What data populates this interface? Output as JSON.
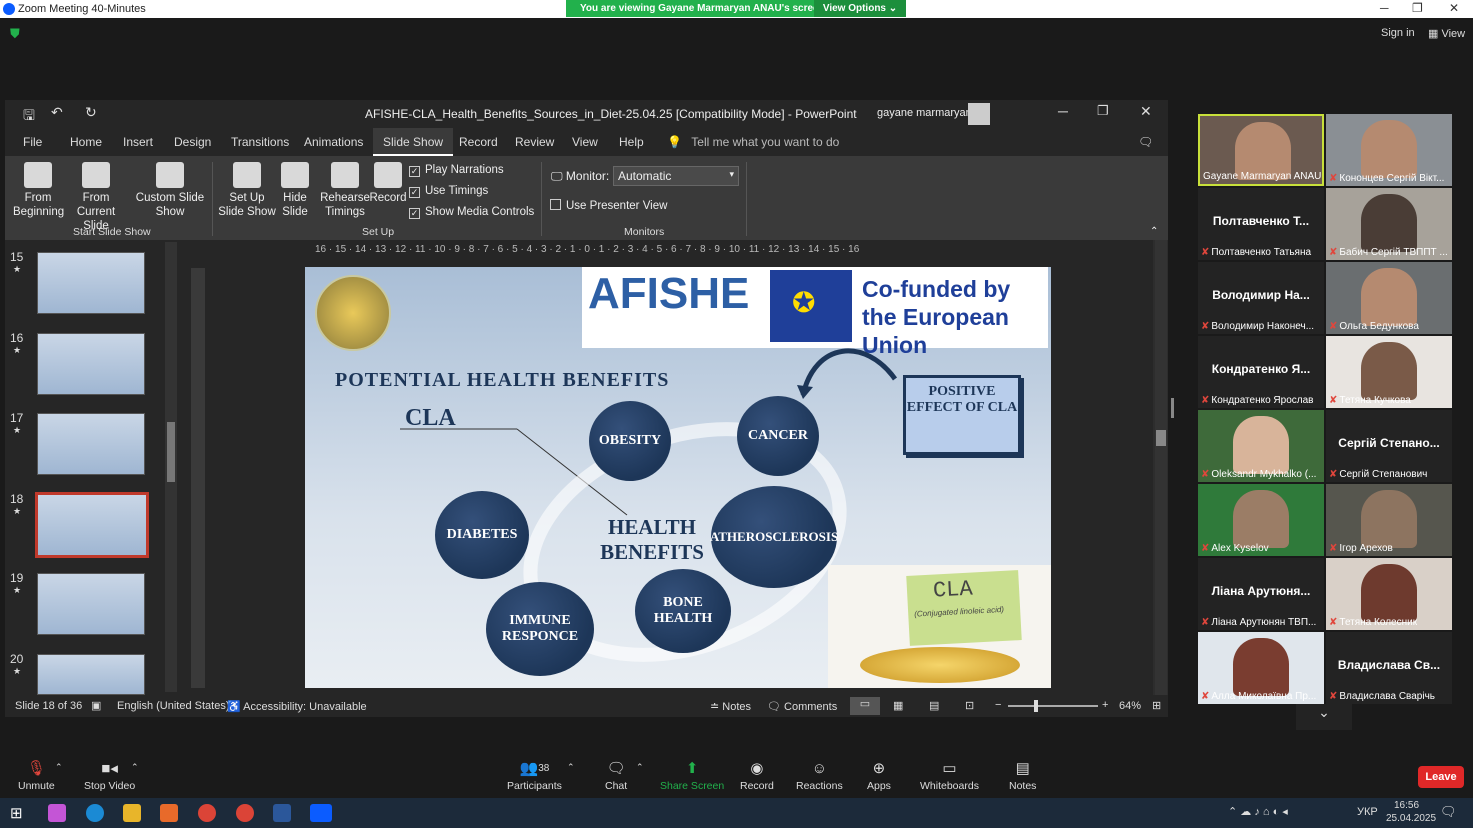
{
  "zoom": {
    "window_title": "Zoom Meeting 40-Minutes",
    "banner_text": "You are viewing Gayane Marmaryan ANAU's screen",
    "view_options": "View Options",
    "sign_in": "Sign in",
    "view": "View"
  },
  "ppt": {
    "title": "AFISHE-CLA_Health_Benefits_Sources_in_Diet-25.04.25 [Compatibility Mode] - PowerPoint",
    "user": "gayane marmaryan",
    "tabs": [
      "File",
      "Home",
      "Insert",
      "Design",
      "Transitions",
      "Animations",
      "Slide Show",
      "Record",
      "Review",
      "View",
      "Help"
    ],
    "tell_me": "Tell me what you want to do",
    "ribbon": {
      "from_beginning": "From Beginning",
      "from_current": "From Current Slide",
      "custom_show": "Custom Slide Show",
      "group1": "Start Slide Show",
      "setup_show": "Set Up Slide Show",
      "hide_slide": "Hide Slide",
      "rehearse": "Rehearse Timings",
      "record": "Record",
      "play_narrations": "Play Narrations",
      "use_timings": "Use Timings",
      "show_media": "Show Media Controls",
      "group2": "Set Up",
      "monitor_label": "Monitor:",
      "monitor_value": "Automatic",
      "presenter_view": "Use Presenter View",
      "group3": "Monitors"
    },
    "ruler_h": "16 · 15 · 14 · 13 · 12 · 11 · 10 · 9 · 8 · 7 · 6 · 5 · 4 · 3 · 2 · 1 · 0 · 1 · 2 · 3 · 4 · 5 · 6 · 7 · 8 · 9 · 10 · 11 · 12 · 13 · 14 · 15 · 16",
    "thumbs": [
      {
        "num": "15"
      },
      {
        "num": "16"
      },
      {
        "num": "17"
      },
      {
        "num": "18"
      },
      {
        "num": "19"
      },
      {
        "num": "20"
      }
    ],
    "slide": {
      "afishe": "AFISHE",
      "cofunded": "Co-funded by the European Union",
      "heading": "POTENTIAL HEALTH BENEFITS",
      "cla": "CLA",
      "positive": "POSITIVE EFFECT OF CLA",
      "center": "HEALTH BENEFITS",
      "obesity": "OBESITY",
      "cancer": "CANCER",
      "diabetes": "DIABETES",
      "athero": "ATHEROSCLEROSIS",
      "immune": "IMMUNE RESPONCE",
      "bone": "BONE HEALTH",
      "note_cla": "CLA",
      "note_sub": "(Conjugated linoleic acid)"
    },
    "status": {
      "slide": "Slide 18 of 36",
      "lang": "English (United States)",
      "access": "Accessibility: Unavailable",
      "notes": "Notes",
      "comments": "Comments",
      "zoom": "64%"
    }
  },
  "participants": [
    {
      "name": "Gayane Marmaryan ANAU",
      "big": ""
    },
    {
      "name": "Кононцев Сергій Вікт...",
      "big": ""
    },
    {
      "name": "Полтавченко Татьяна",
      "big": "Полтавченко Т..."
    },
    {
      "name": "Бабич Сергій ТВППТ ...",
      "big": ""
    },
    {
      "name": "Володимир Наконеч...",
      "big": "Володимир На..."
    },
    {
      "name": "Ольга Бедункова",
      "big": ""
    },
    {
      "name": "Кондратенко Ярослав",
      "big": "Кондратенко Я..."
    },
    {
      "name": "Тетяна Кучкова",
      "big": ""
    },
    {
      "name": "Oleksandr Mykhalko (...",
      "big": ""
    },
    {
      "name": "Сергій Степанович",
      "big": "Сергій Степано..."
    },
    {
      "name": "Alex Kyselov",
      "big": ""
    },
    {
      "name": "Ігор Арехов",
      "big": ""
    },
    {
      "name": "Ліана Арутюнян ТВП...",
      "big": "Ліана Арутюня..."
    },
    {
      "name": "Тетяна Колесник",
      "big": ""
    },
    {
      "name": "Алла Миколаївна Пр...",
      "big": ""
    },
    {
      "name": "Владислава Сварічь",
      "big": "Владислава Св..."
    }
  ],
  "toolbar": {
    "unmute": "Unmute",
    "stop_video": "Stop Video",
    "participants": "Participants",
    "count": "38",
    "chat": "Chat",
    "share": "Share Screen",
    "record": "Record",
    "reactions": "Reactions",
    "apps": "Apps",
    "whiteboards": "Whiteboards",
    "notes": "Notes",
    "leave": "Leave"
  },
  "taskbar": {
    "lang": "УКР",
    "time": "16:56",
    "date": "25.04.2025"
  },
  "colors": {
    "share_green": "#22b14c",
    "leave_red": "#e02828",
    "slide_navy": "#1d3658",
    "active_border": "#c0392b"
  }
}
